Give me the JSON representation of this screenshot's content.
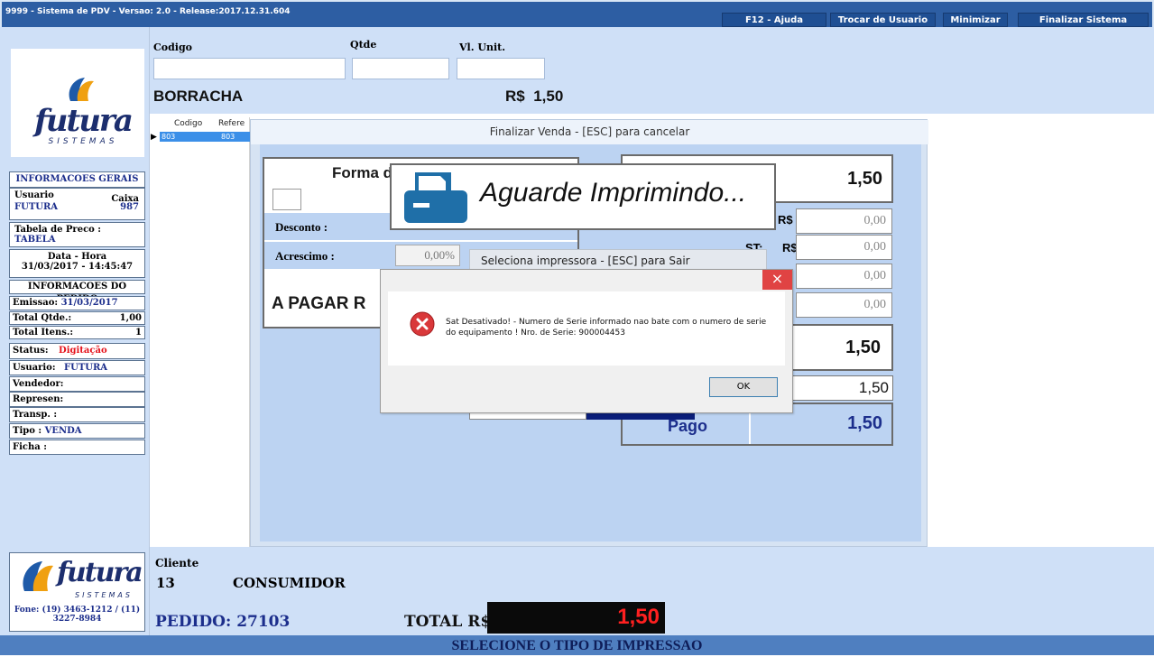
{
  "window": {
    "title": "9999 - Sistema de PDV - Versao: 2.0 - Release:2017.12.31.604",
    "buttons": [
      "F12 - Ajuda",
      "Trocar de Usuario",
      "Minimizar",
      "Finalizar Sistema"
    ]
  },
  "sidebar": {
    "header": "INFORMACOES GERAIS",
    "usuario_label": "Usuario",
    "usuario_value": "FUTURA",
    "caixa_label": "Caixa",
    "caixa_value": "987",
    "tabela_label": "Tabela de Preco :",
    "tabela_value": "TABELA",
    "datahora_label": "Data - Hora",
    "datahora_value": "31/03/2017 - 14:45:47",
    "pedido_header": "INFORMACOES DO PEDIDO",
    "emissao_label": "Emissao:",
    "emissao_value": "31/03/2017",
    "total_qtde_label": "Total Qtde.:",
    "total_qtde_value": "1,00",
    "total_itens_label": "Total Itens.:",
    "total_itens_value": "1",
    "status_label": "Status:",
    "status_value": "Digitação",
    "usuario2_label": "Usuario:",
    "usuario2_value": "FUTURA",
    "vendedor_label": "Vendedor:",
    "represen_label": "Represen:",
    "transp_label": "Transp. :",
    "tipo_label": "Tipo :",
    "tipo_value": "VENDA",
    "ficha_label": "Ficha :",
    "fone": "Fone: (19) 3463-1212 / (11) 3227-8984",
    "logo_text": "futura",
    "logo_sub": "SISTEMAS"
  },
  "form": {
    "codigo_label": "Codigo",
    "qtde_label": "Qtde",
    "vl_unit_label": "Vl. Unit.",
    "product_name": "BORRACHA",
    "currency": "R$",
    "product_price": "1,50"
  },
  "grid": {
    "col1": "Codigo",
    "col2": "Refere",
    "row_codigo": "803",
    "row_ref": "803"
  },
  "finalizar": {
    "title": "Finalizar Venda - [ESC] para cancelar",
    "forma_label": "Forma d",
    "desconto_label": "Desconto :",
    "acrescimo_label": "Acrescimo :",
    "acrescimo_pct": "0,00%",
    "a_pagar_label": "A PAGAR  R",
    "total_top": "1,50",
    "rs_label": "R$",
    "val1": "0,00",
    "val2": "0,00",
    "val3": "0,00",
    "val4": "0,00",
    "st_label": "ST:",
    "total_mid": "1,50",
    "pago_input": "1,50",
    "pago_label": "Pago",
    "pago_value": "1,50"
  },
  "imprimindo": {
    "text": "Aguarde Imprimindo..."
  },
  "seleciona": {
    "title": "Seleciona impressora - [ESC] para Sair"
  },
  "error": {
    "message": "Sat Desativado! - Numero de Serie informado nao bate com o numero de serie do equipamento ! Nro. de Serie: 900004453",
    "ok": "OK",
    "close": "×"
  },
  "bottom": {
    "cliente_label": "Cliente",
    "cliente_code": "13",
    "cliente_name": "CONSUMIDOR",
    "pedido_label": "PEDIDO:",
    "pedido_value": "27103",
    "total_label": "TOTAL R$",
    "total_value": "1,50"
  },
  "status_bar": "SELECIONE O TIPO DE IMPRESSAO",
  "colors": {
    "title_bar": "#2d5ea3",
    "panel_bg": "#cfe0f7",
    "accent_blue": "#1c2e8c",
    "status_red": "#e5121b",
    "total_red": "#ff2020"
  }
}
